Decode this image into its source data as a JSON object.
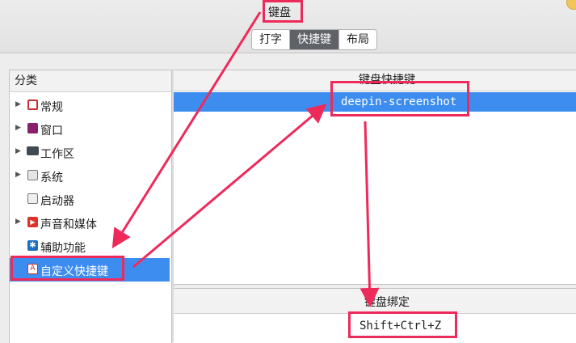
{
  "window": {
    "title": "键盘"
  },
  "tabs": [
    {
      "label": "打字",
      "active": false
    },
    {
      "label": "快捷键",
      "active": true
    },
    {
      "label": "布局",
      "active": false
    }
  ],
  "sidebar": {
    "header": "分类",
    "items": [
      {
        "label": "常规",
        "icon": "general-icon",
        "expandable": true,
        "selected": false
      },
      {
        "label": "窗口",
        "icon": "window-icon",
        "expandable": true,
        "selected": false
      },
      {
        "label": "工作区",
        "icon": "workspace-icon",
        "expandable": true,
        "selected": false
      },
      {
        "label": "系统",
        "icon": "system-icon",
        "expandable": true,
        "selected": false
      },
      {
        "label": "启动器",
        "icon": "launcher-icon",
        "expandable": false,
        "selected": false
      },
      {
        "label": "声音和媒体",
        "icon": "media-icon",
        "expandable": true,
        "selected": false
      },
      {
        "label": "辅助功能",
        "icon": "accessibility-icon",
        "expandable": false,
        "selected": false
      },
      {
        "label": "自定义快捷键",
        "icon": "custom-shortcut-icon",
        "expandable": false,
        "selected": true
      }
    ]
  },
  "shortcuts": {
    "header": "键盘快捷键",
    "rows": [
      {
        "name": "deepin-screenshot",
        "selected": true
      }
    ]
  },
  "binding": {
    "header": "键盘绑定",
    "value": "Shift+Ctrl+Z"
  },
  "colors": {
    "selection": "#3d8df0",
    "annotation": "#ee2a5b"
  }
}
